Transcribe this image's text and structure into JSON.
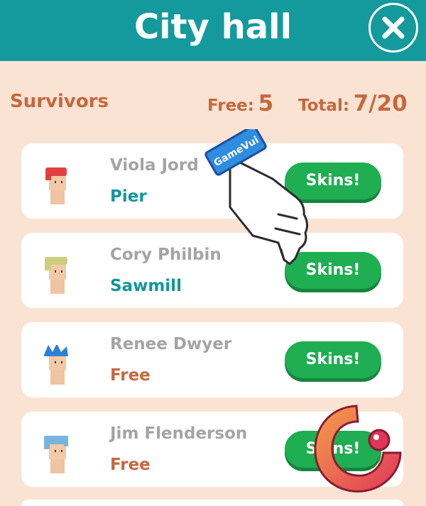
{
  "header": {
    "title": "City hall",
    "close_icon": "close-icon"
  },
  "stats": {
    "section_label": "Survivors",
    "free_label": "Free:",
    "free_value": "5",
    "total_label": "Total:",
    "total_value": "7/20"
  },
  "survivors": [
    {
      "name": "Viola Jord",
      "location": "Pier",
      "hair_color": "#e3413f",
      "button": "Skins!"
    },
    {
      "name": "Cory Philbin",
      "location": "Sawmill",
      "hair_color": "#c9cf7d",
      "button": "Skins!"
    },
    {
      "name": "Renee Dwyer",
      "location": "Free",
      "hair_color": "#2f7fd6",
      "button": "Skins!"
    },
    {
      "name": "Jim Flenderson",
      "location": "Free",
      "hair_color": "#78b5dc",
      "button": "Skins!"
    }
  ],
  "tutorial_hand": {
    "icon": "pointing-hand-icon",
    "wristband_text": "GameVui"
  },
  "watermark": {
    "icon": "logo-icon"
  },
  "colors": {
    "header": "#149a9c",
    "background": "#fbe3d3",
    "button": "#1fae52",
    "accent": "#c5683d",
    "location_teal": "#11979b"
  }
}
